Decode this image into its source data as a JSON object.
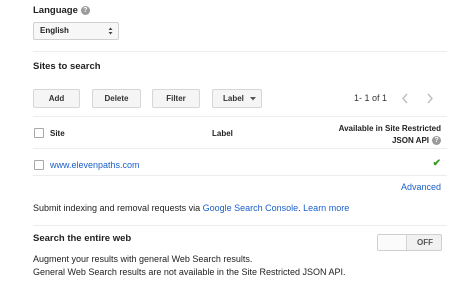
{
  "language": {
    "title": "Language",
    "help_icon": "?",
    "selected": "English"
  },
  "sites": {
    "title": "Sites to search",
    "buttons": {
      "add": "Add",
      "delete": "Delete",
      "filter": "Filter",
      "label": "Label"
    },
    "pagination": "1- 1 of 1",
    "columns": {
      "site": "Site",
      "label": "Label",
      "available_line1": "Available in Site Restricted",
      "available_line2": "JSON API"
    },
    "rows": [
      {
        "site": "www.elevenpaths.com",
        "label": "",
        "available": "✔"
      }
    ],
    "advanced": "Advanced"
  },
  "indexing": {
    "text": "Submit indexing and removal requests via ",
    "console_link": "Google Search Console",
    "separator": ". ",
    "learn_more": "Learn more"
  },
  "entire_web": {
    "title": "Search the entire web",
    "toggle": "OFF",
    "line1": "Augment your results with general Web Search results.",
    "line2": "General Web Search results are not available in the Site Restricted JSON API."
  },
  "colors": {
    "link": "#1a5fc9",
    "check": "#3c9a29"
  }
}
